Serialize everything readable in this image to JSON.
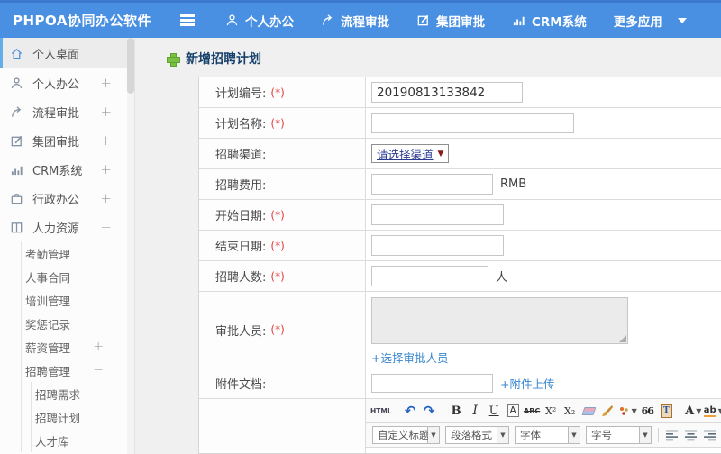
{
  "header": {
    "brand": "PHPOA协同办公软件",
    "nav": [
      {
        "label": "个人办公",
        "icon": "user-icon"
      },
      {
        "label": "流程审批",
        "icon": "workflow-icon"
      },
      {
        "label": "集团审批",
        "icon": "edit-icon"
      },
      {
        "label": "CRM系统",
        "icon": "chart-icon"
      },
      {
        "label": "更多应用",
        "icon": "caret-down-icon"
      }
    ]
  },
  "sidebar": {
    "items": [
      {
        "label": "个人桌面",
        "icon": "home-icon",
        "active": true
      },
      {
        "label": "个人办公",
        "icon": "user-icon",
        "expander": "+"
      },
      {
        "label": "流程审批",
        "icon": "workflow-icon",
        "expander": "+"
      },
      {
        "label": "集团审批",
        "icon": "edit-icon",
        "expander": "+"
      },
      {
        "label": "CRM系统",
        "icon": "chart-icon",
        "expander": "+"
      },
      {
        "label": "行政办公",
        "icon": "briefcase-icon",
        "expander": "+"
      },
      {
        "label": "人力资源",
        "icon": "hr-book-icon",
        "expander": "−"
      }
    ],
    "hr_children": [
      {
        "label": "考勤管理"
      },
      {
        "label": "人事合同"
      },
      {
        "label": "培训管理"
      },
      {
        "label": "奖惩记录"
      },
      {
        "label": "薪资管理",
        "expander": "+"
      },
      {
        "label": "招聘管理",
        "expander": "−"
      }
    ],
    "recruit_children": [
      {
        "label": "招聘需求"
      },
      {
        "label": "招聘计划"
      },
      {
        "label": "人才库"
      }
    ]
  },
  "main": {
    "title": "新增招聘计划",
    "form": {
      "rows": [
        {
          "label": "计划编号:",
          "required": "(*)",
          "value": "20190813133842"
        },
        {
          "label": "计划名称:",
          "required": "(*)",
          "value": ""
        },
        {
          "label": "招聘渠道:",
          "select_value": "请选择渠道"
        },
        {
          "label": "招聘费用:",
          "value": "",
          "suffix": "RMB"
        },
        {
          "label": "开始日期:",
          "required": "(*)",
          "value": ""
        },
        {
          "label": "结束日期:",
          "required": "(*)",
          "value": ""
        },
        {
          "label": "招聘人数:",
          "required": "(*)",
          "value": "",
          "suffix": "人"
        },
        {
          "label": "审批人员:",
          "required": "(*)",
          "link": "+选择审批人员"
        },
        {
          "label": "附件文档:",
          "value": "",
          "link": "+附件上传"
        }
      ]
    },
    "editor": {
      "source_label": "HTML",
      "bold_label": "B",
      "italic_label": "I",
      "underline_label": "U",
      "char_border_label": "A",
      "strike_label": "ABC",
      "superscript_label": "X²",
      "subscript_label": "X₂",
      "quote_label": "66",
      "paste_text_label": "T",
      "font_color_label": "A",
      "highlight_label": "ab",
      "style_select": "自定义标题",
      "format_select": "段落格式",
      "font_select": "字体",
      "size_select": "字号"
    }
  },
  "colors": {
    "header_bg": "#4a90e2",
    "sidebar_active_border": "#63aee8",
    "title_navy": "#17406b",
    "required_red": "#e5413e",
    "plus_green": "#79c043",
    "link_blue": "#3a87d0",
    "select_text": "#2b3990"
  }
}
